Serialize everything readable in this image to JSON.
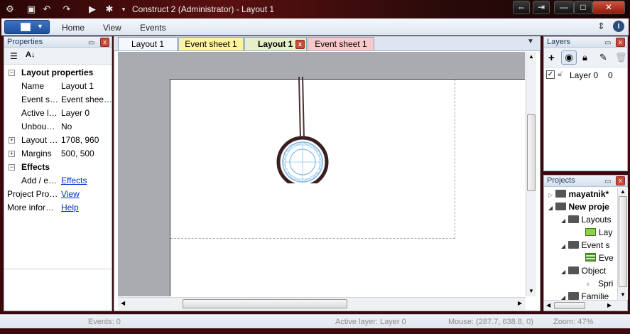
{
  "window": {
    "title": "Construct 2 (Administrator) - Layout 1",
    "controls": {
      "restore": "⇔",
      "exit": "⇥",
      "minimize": "—",
      "maximize": "□",
      "close": "✕"
    }
  },
  "ribbon": {
    "tabs": [
      {
        "label": "Home"
      },
      {
        "label": "View"
      },
      {
        "label": "Events"
      }
    ]
  },
  "properties": {
    "title": "Properties",
    "rows": [
      {
        "kind": "header",
        "label": "Layout properties",
        "expander": "−"
      },
      {
        "name": "Name",
        "value": "Layout 1"
      },
      {
        "name": "Event s…",
        "value": "Event shee…"
      },
      {
        "name": "Active l…",
        "value": "Layer 0"
      },
      {
        "name": "Unbou…",
        "value": "No"
      },
      {
        "name": "Layout …",
        "value": "1708, 960",
        "expander": "+"
      },
      {
        "name": "Margins",
        "value": "500, 500",
        "expander": "+"
      },
      {
        "kind": "header",
        "label": "Effects",
        "expander": "−"
      },
      {
        "name": "Add / e…",
        "value": "Effects",
        "link": true
      },
      {
        "name": "Project Pro…",
        "value": "View",
        "link": true,
        "flush": true
      },
      {
        "name": "More infor…",
        "value": "Help",
        "link": true,
        "flush": true
      }
    ]
  },
  "doc_tabs": [
    {
      "label": "Layout 1",
      "bg": "#f4f7fb",
      "bold": false
    },
    {
      "label": "Event sheet 1",
      "bg": "#fff3a0",
      "bold": false
    },
    {
      "label": "Layout 1",
      "bg": "#e6f0c8",
      "bold": true,
      "closable": true
    },
    {
      "label": "Event sheet 1",
      "bg": "#f9c9c9",
      "bold": false
    }
  ],
  "layers": {
    "title": "Layers",
    "items": [
      {
        "name": "Layer 0",
        "index": "0",
        "visible": true
      }
    ]
  },
  "projects": {
    "title": "Projects",
    "tree": [
      {
        "label": "mayatnik*",
        "bold": true,
        "level": 0,
        "arrow": "▷"
      },
      {
        "label": "New proje",
        "bold": true,
        "level": 0,
        "arrow": "◢"
      },
      {
        "label": "Layouts",
        "level": 1,
        "arrow": "◢"
      },
      {
        "label": "Lay",
        "level": 2
      },
      {
        "label": "Event s",
        "level": 1,
        "arrow": "◢"
      },
      {
        "label": "Eve",
        "level": 2
      },
      {
        "label": "Object",
        "level": 1,
        "arrow": "◢"
      },
      {
        "label": "Spri",
        "level": 2
      },
      {
        "label": "Familie",
        "level": 1,
        "arrow": "◢"
      }
    ]
  },
  "status": {
    "events": "Events: 0",
    "active_layer": "Active layer: Layer 0",
    "mouse": "Mouse: (287.7, 638.8, 0)",
    "zoom": "Zoom: 47%"
  },
  "colors": {
    "ribbon_accent": "#1d4f9c",
    "link": "#0033cc",
    "status_text": "#8a8a8a"
  }
}
